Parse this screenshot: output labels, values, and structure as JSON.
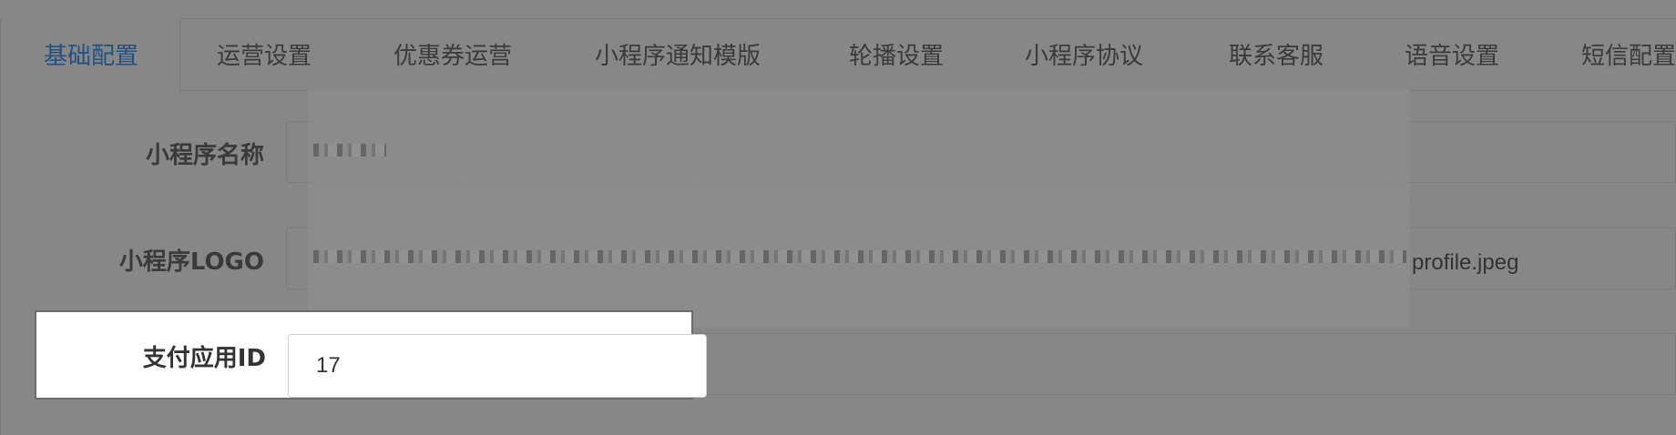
{
  "tabs": [
    {
      "label": "基础配置",
      "active": true
    },
    {
      "label": "运营设置"
    },
    {
      "label": "优惠券运营"
    },
    {
      "label": "小程序通知模版"
    },
    {
      "label": "轮播设置"
    },
    {
      "label": "小程序协议"
    },
    {
      "label": "联系客服"
    },
    {
      "label": "语音设置"
    },
    {
      "label": "短信配置"
    }
  ],
  "form": {
    "name_label": "小程序名称",
    "logo_label": "小程序LOGO",
    "logo_value_tail": "profile.jpeg",
    "pay_app_label": "支付应用ID",
    "pay_app_value": "17"
  },
  "colors": {
    "overlay": "#878787",
    "active_tab": "#1f5287",
    "highlight_bg": "#ffffff"
  }
}
